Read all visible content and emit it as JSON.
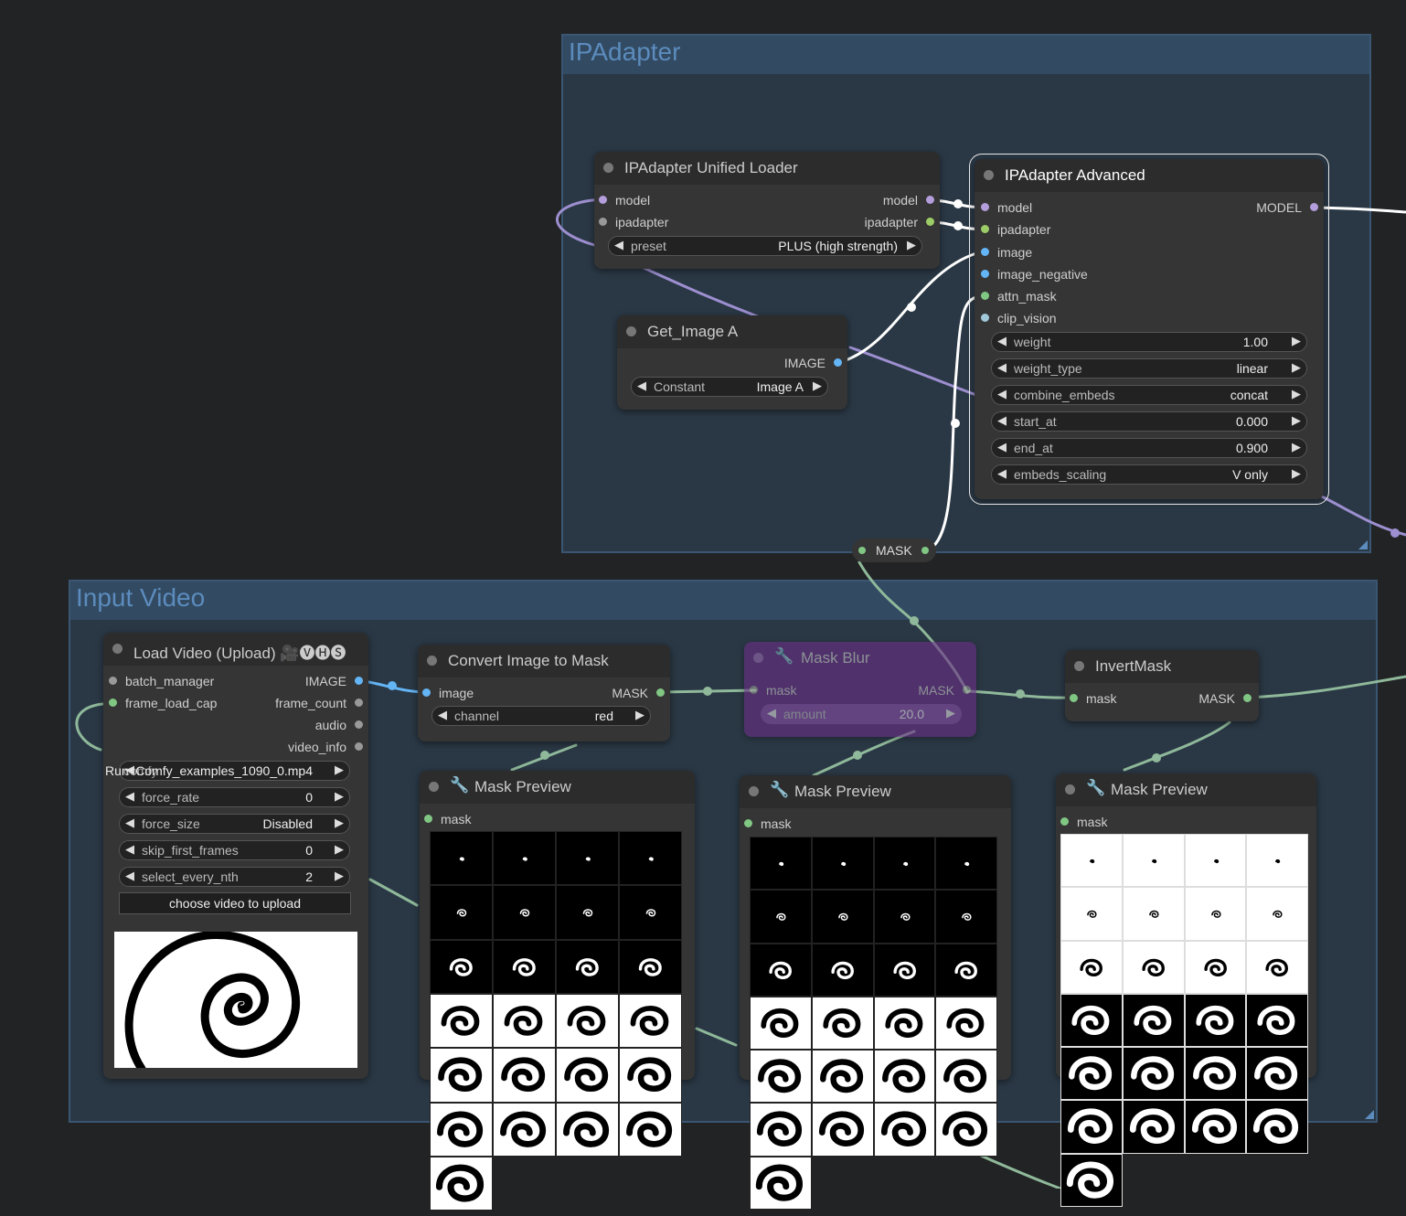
{
  "groups": {
    "ipadapter": {
      "title": "IPAdapter"
    },
    "input_video": {
      "title": "Input Video"
    }
  },
  "nodes": {
    "unified_loader": {
      "title": "IPAdapter Unified Loader",
      "inputs": [
        "model",
        "ipadapter"
      ],
      "outputs": [
        "model",
        "ipadapter"
      ],
      "preset": {
        "label": "preset",
        "value": "PLUS (high strength)"
      }
    },
    "get_image": {
      "title": "Get_Image A",
      "output": "IMAGE",
      "constant": {
        "label": "Constant",
        "value": "Image A"
      }
    },
    "ipadapter_advanced": {
      "title": "IPAdapter Advanced",
      "inputs": [
        "model",
        "ipadapter",
        "image",
        "image_negative",
        "attn_mask",
        "clip_vision"
      ],
      "output": "MODEL",
      "widgets": [
        {
          "label": "weight",
          "value": "1.00"
        },
        {
          "label": "weight_type",
          "value": "linear"
        },
        {
          "label": "combine_embeds",
          "value": "concat"
        },
        {
          "label": "start_at",
          "value": "0.000"
        },
        {
          "label": "end_at",
          "value": "0.900"
        },
        {
          "label": "embeds_scaling",
          "value": "V only"
        }
      ]
    },
    "mask_reroute": {
      "label": "MASK"
    },
    "load_video": {
      "title": "Load Video (Upload) 🎥🅥🅗🅢",
      "inputs": [
        "batch_manager",
        "frame_load_cap"
      ],
      "outputs": [
        "IMAGE",
        "frame_count",
        "audio",
        "video_info"
      ],
      "file": {
        "label": "Run",
        "overlap_label": "comfy",
        "value": "Comfy_examples_1090_0.mp4"
      },
      "widgets": [
        {
          "label": "force_rate",
          "value": "0"
        },
        {
          "label": "force_size",
          "value": "Disabled"
        },
        {
          "label": "skip_first_frames",
          "value": "0"
        },
        {
          "label": "select_every_nth",
          "value": "2"
        }
      ],
      "upload_button": "choose video to upload"
    },
    "convert_mask": {
      "title": "Convert Image to Mask",
      "input": "image",
      "output": "MASK",
      "channel": {
        "label": "channel",
        "value": "red"
      }
    },
    "mask_blur": {
      "title": "Mask Blur",
      "input": "mask",
      "output": "MASK",
      "amount": {
        "label": "amount",
        "value": "20.0"
      }
    },
    "invert_mask": {
      "title": "InvertMask",
      "input": "mask",
      "output": "MASK"
    },
    "preview1": {
      "title": "Mask Preview",
      "input": "mask"
    },
    "preview2": {
      "title": "Mask Preview",
      "input": "mask"
    },
    "preview3": {
      "title": "Mask Preview",
      "input": "mask"
    }
  },
  "colors": {
    "model": "#b39ddb",
    "ipadapter": "#9ccc65",
    "image": "#64b5f6",
    "mask": "#81c784",
    "group_title": "#5c8cbd",
    "bypass": "#6a2e85"
  },
  "preview_frames": {
    "preview1": [
      0,
      0,
      0,
      0,
      1,
      1,
      1,
      1,
      2,
      2,
      2,
      2,
      3,
      3,
      3,
      3,
      4,
      4,
      4,
      4,
      5,
      5,
      5,
      5,
      6
    ],
    "preview2": [
      0,
      0,
      0,
      0,
      1,
      1,
      1,
      1,
      2,
      2,
      2,
      2,
      3,
      3,
      3,
      3,
      4,
      4,
      4,
      4,
      5,
      5,
      5,
      5,
      6
    ],
    "preview3": [
      0,
      0,
      0,
      0,
      1,
      1,
      1,
      1,
      2,
      2,
      2,
      2,
      3,
      3,
      3,
      3,
      4,
      4,
      4,
      4,
      5,
      5,
      5,
      5,
      6
    ]
  }
}
